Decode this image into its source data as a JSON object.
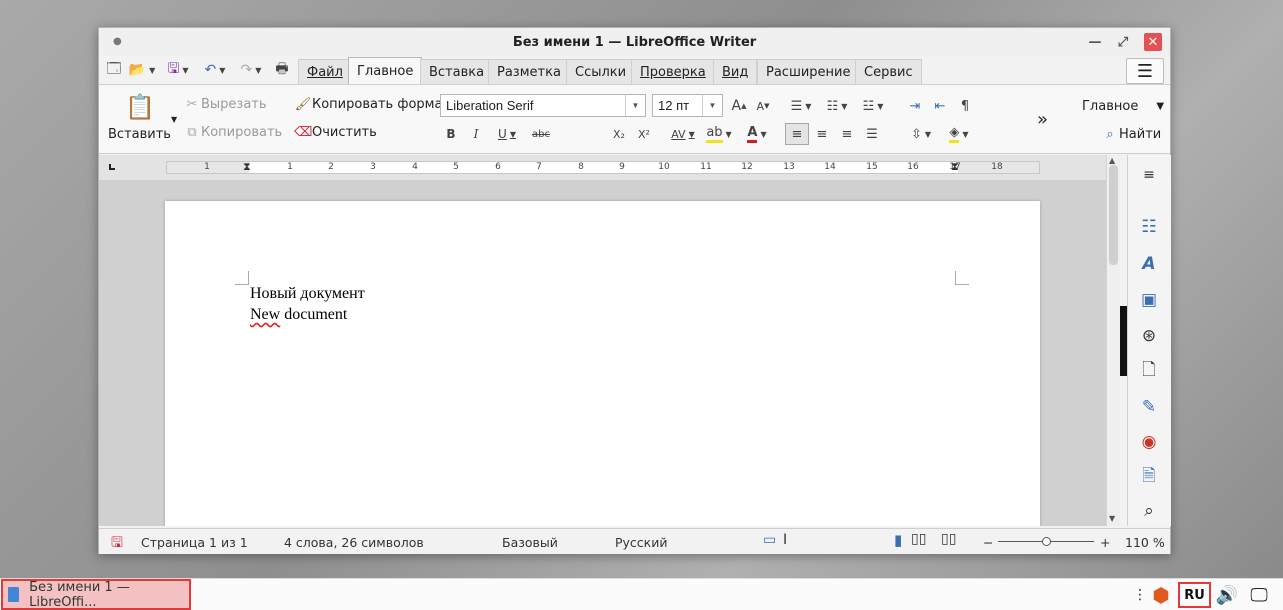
{
  "window": {
    "title": "Без имени 1 — LibreOffice Writer"
  },
  "menu": {
    "tabs": [
      {
        "label": "Файл"
      },
      {
        "label": "Главное"
      },
      {
        "label": "Вставка"
      },
      {
        "label": "Разметка"
      },
      {
        "label": "Ссылки"
      },
      {
        "label": "Проверка"
      },
      {
        "label": "Вид"
      },
      {
        "label": "Расширение"
      },
      {
        "label": "Сервис"
      }
    ],
    "active_tab": "Главное"
  },
  "ribbon": {
    "paste_label": "Вставить",
    "cut_label": "Вырезать",
    "copy_label": "Копировать",
    "clone_format_label": "Копировать формат",
    "clear_label": "Очистить",
    "font_name": "Liberation Serif",
    "font_size": "12 пт",
    "style_name": "Главное",
    "find_label": "Найти",
    "bold": "B",
    "italic": "I",
    "underline": "U",
    "strike": "abc",
    "subscript": "X₂",
    "superscript": "X²",
    "spacing": "AV",
    "font_color_letter": "A",
    "grow_font": "A",
    "shrink_font": "A"
  },
  "ruler": {
    "numbers": [
      "1",
      "1",
      "2",
      "3",
      "4",
      "5",
      "6",
      "7",
      "8",
      "9",
      "10",
      "11",
      "12",
      "13",
      "14",
      "15",
      "16",
      "17",
      "18"
    ]
  },
  "document": {
    "lines": [
      "Новый документ",
      "New document"
    ]
  },
  "status": {
    "page": "Страница 1 из 1",
    "words": "4 слова, 26 символов",
    "style": "Базовый",
    "language": "Русский",
    "zoom": "110 %",
    "zoom_minus": "−",
    "zoom_plus": "+"
  },
  "taskbar": {
    "task_title": "Без имени 1 — LibreOffi...",
    "keyboard_layout": "RU"
  },
  "colors": {
    "highlight_red": "#e23a3a",
    "accent_blue": "#3b6fb0",
    "font_color_bar": "#d22020",
    "highlight_yellow": "#f3e21a"
  }
}
